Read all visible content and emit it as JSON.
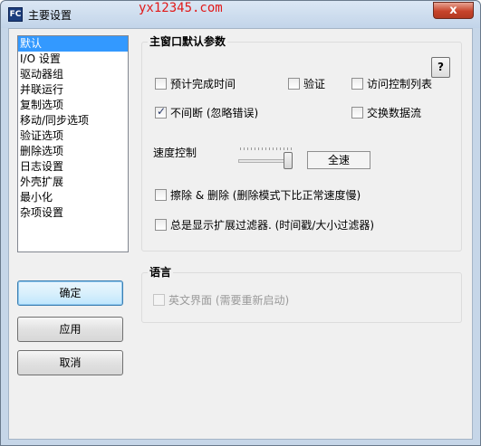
{
  "window": {
    "title": "主要设置",
    "app_icon_text": "FC",
    "watermark": "yx12345.com",
    "close_label": "x"
  },
  "nav": {
    "items": [
      {
        "label": "默认",
        "selected": true
      },
      {
        "label": "I/O 设置"
      },
      {
        "label": "驱动器组"
      },
      {
        "label": "并联运行"
      },
      {
        "label": "复制选项"
      },
      {
        "label": "移动/同步选项"
      },
      {
        "label": "验证选项"
      },
      {
        "label": "删除选项"
      },
      {
        "label": "日志设置"
      },
      {
        "label": "外壳扩展"
      },
      {
        "label": "最小化"
      },
      {
        "label": "杂项设置"
      }
    ]
  },
  "main_group": {
    "title": "主窗口默认参数",
    "help_label": "?",
    "options": {
      "estimate_time": {
        "label": "预计完成时间",
        "checked": false
      },
      "verify": {
        "label": "验证",
        "checked": false
      },
      "acl_list": {
        "label": "访问控制列表",
        "checked": false
      },
      "continue_on_error": {
        "label": "不间断 (忽略错误)",
        "checked": true
      },
      "exchange_streams": {
        "label": "交换数据流",
        "checked": false
      },
      "wipe_delete": {
        "label": "擦除 & 删除 (删除模式下比正常速度慢)",
        "checked": false
      },
      "extended_filter": {
        "label": "总是显示扩展过滤器. (时间戳/大小过滤器)",
        "checked": false
      }
    },
    "speed_label": "速度控制",
    "speed_value": "全速",
    "speed_level": 1.0
  },
  "language_group": {
    "title": "语言",
    "english_ui": {
      "label": "英文界面 (需要重新启动)",
      "checked": false,
      "disabled": true
    }
  },
  "buttons": {
    "ok": "确定",
    "apply": "应用",
    "cancel": "取消"
  }
}
